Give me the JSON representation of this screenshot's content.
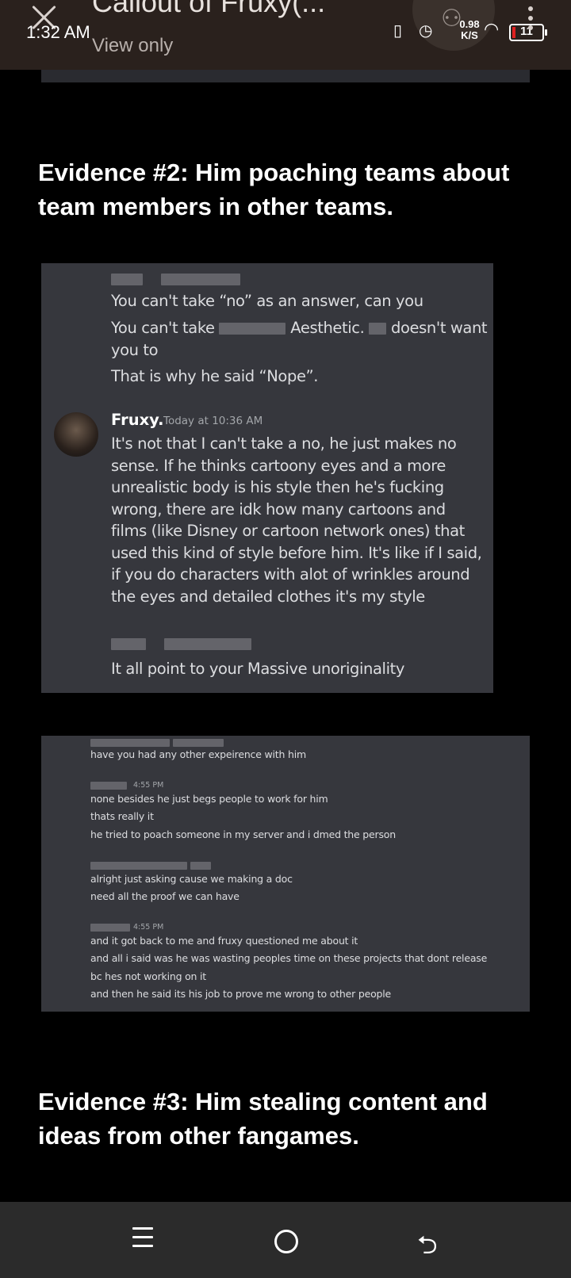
{
  "header": {
    "title": "Callout of Fruxy(...",
    "subtitle": "View only",
    "time": "1:32 AM",
    "net_speed": "0.98",
    "net_unit": "K/S",
    "battery": "11"
  },
  "sections": {
    "evidence2": "Evidence #2: Him poaching teams about team members in other teams.",
    "evidence3": "Evidence #3: Him stealing content and ideas from other fangames."
  },
  "screenshot1": {
    "line1": "You can't take “no” as an answer, can you",
    "line2a": "You can't take",
    "line2b": "Aesthetic.",
    "line2c": "doesn't want",
    "line3": "you to",
    "line4": "That is why he said “Nope”.",
    "author": "Fruxy.",
    "timestamp": "Today at 10:36 AM",
    "message": "It's not that I can't take a no, he just makes no sense. If he thinks cartoony eyes and a more unrealistic body is his style then he's fucking wrong, there are idk how many cartoons and films (like Disney or cartoon network ones) that used this kind of style before him. It's like if I said, if you do characters with alot of wrinkles around the eyes and detailed clothes it's my style",
    "reply": "It all point to your Massive unoriginality"
  },
  "screenshot2": {
    "l1": "have you had any other expeirence with him",
    "stamp1": "4:55 PM",
    "l2": "none besides he just begs people to work for him",
    "l3": "thats really it",
    "l4": "he tried to poach someone in my server and i dmed the person",
    "l5": "alright just asking cause we making a doc",
    "l6": "need all the proof we can have",
    "stamp2": "4:55 PM",
    "l7": "and it got back to me and fruxy questioned me about it",
    "l8": "and all i said was he was wasting peoples time on these projects that dont release",
    "l9": "bc hes not working on it",
    "l10": "and then he said its his job to prove me wrong to other people"
  },
  "icons": [
    "close-icon",
    "add-person-icon",
    "vibrate-icon",
    "alarm-icon",
    "wifi-icon",
    "battery-icon",
    "more-icon",
    "menu-icon",
    "home-icon",
    "back-icon"
  ]
}
